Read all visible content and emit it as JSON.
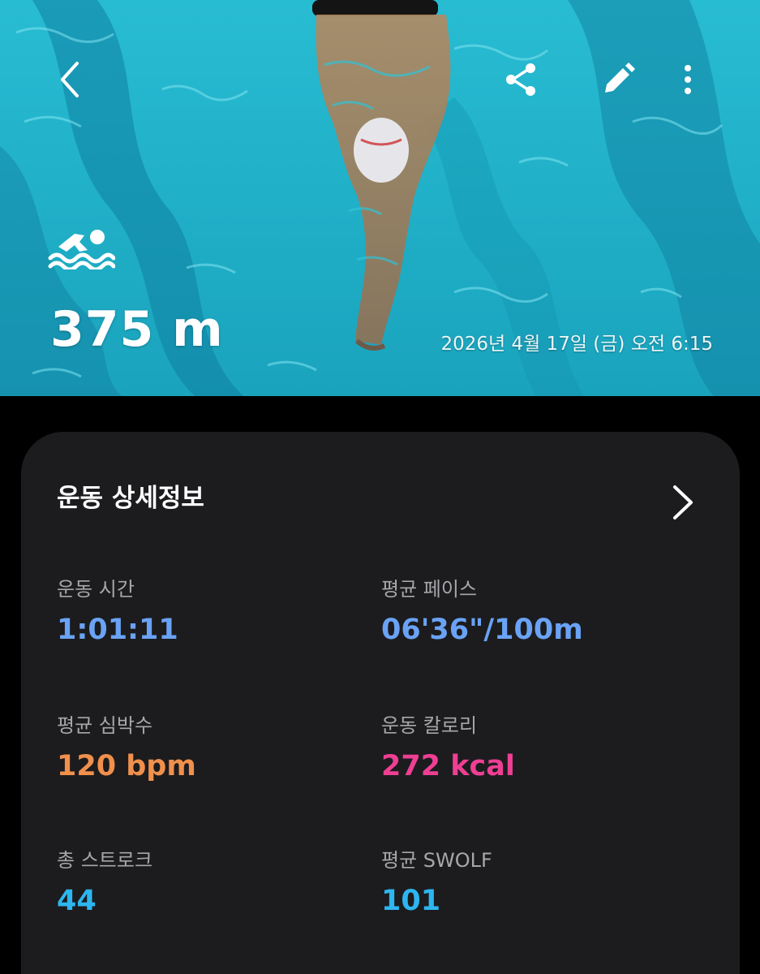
{
  "hero": {
    "distance": "375 m",
    "datetime": "2026년 4월 17일 (금) 오전 6:15",
    "icons": {
      "back": "chevron-left-icon",
      "share": "share-icon",
      "edit": "pencil-icon",
      "more": "more-vertical-icon",
      "activity": "swimming-icon"
    }
  },
  "details": {
    "title": "운동 상세정보",
    "metrics": [
      {
        "label": "운동 시간",
        "value": "1:01:11",
        "color": "#6aa3f5"
      },
      {
        "label": "평균 페이스",
        "value": "06'36\"/100m",
        "color": "#6aa3f5"
      },
      {
        "label": "평균 심박수",
        "value": "120 bpm",
        "color": "#f0904c"
      },
      {
        "label": "운동 칼로리",
        "value": "272 kcal",
        "color": "#ee3f94"
      },
      {
        "label": "총 스트로크",
        "value": "44",
        "color": "#2db6f0"
      },
      {
        "label": "평균 SWOLF",
        "value": "101",
        "color": "#2db6f0"
      }
    ]
  }
}
